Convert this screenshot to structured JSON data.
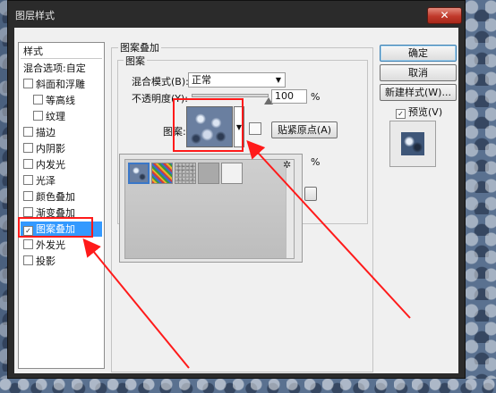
{
  "window": {
    "title": "图层样式",
    "close_label": "✕"
  },
  "style_list": {
    "header": "样式",
    "items": [
      {
        "label": "混合选项:自定",
        "has_checkbox": false,
        "checked": false,
        "selected": false,
        "indent": false
      },
      {
        "label": "斜面和浮雕",
        "has_checkbox": true,
        "checked": false,
        "selected": false,
        "indent": false
      },
      {
        "label": "等高线",
        "has_checkbox": true,
        "checked": false,
        "selected": false,
        "indent": true
      },
      {
        "label": "纹理",
        "has_checkbox": true,
        "checked": false,
        "selected": false,
        "indent": true
      },
      {
        "label": "描边",
        "has_checkbox": true,
        "checked": false,
        "selected": false,
        "indent": false
      },
      {
        "label": "内阴影",
        "has_checkbox": true,
        "checked": false,
        "selected": false,
        "indent": false
      },
      {
        "label": "内发光",
        "has_checkbox": true,
        "checked": false,
        "selected": false,
        "indent": false
      },
      {
        "label": "光泽",
        "has_checkbox": true,
        "checked": false,
        "selected": false,
        "indent": false
      },
      {
        "label": "颜色叠加",
        "has_checkbox": true,
        "checked": false,
        "selected": false,
        "indent": false
      },
      {
        "label": "渐变叠加",
        "has_checkbox": true,
        "checked": false,
        "selected": false,
        "indent": false
      },
      {
        "label": "图案叠加",
        "has_checkbox": true,
        "checked": true,
        "selected": true,
        "indent": false
      },
      {
        "label": "外发光",
        "has_checkbox": true,
        "checked": false,
        "selected": false,
        "indent": false
      },
      {
        "label": "投影",
        "has_checkbox": true,
        "checked": false,
        "selected": false,
        "indent": false
      }
    ]
  },
  "panel": {
    "group_title": "图案叠加",
    "subgroup_title": "图案",
    "blend_mode_label": "混合模式(B):",
    "blend_mode_value": "正常",
    "opacity_label": "不透明度(Y):",
    "opacity_value": "100",
    "opacity_unit": "%",
    "opacity_level": 1.0,
    "pattern_label": "图案:",
    "snap_origin_button": "贴紧原点(A)",
    "scale_unit": "%"
  },
  "side_buttons": {
    "ok": "确定",
    "cancel": "取消",
    "new_style": "新建样式(W)...",
    "preview_label": "预览(V)",
    "preview_checked": true
  },
  "pattern_picker": {
    "patterns": [
      "blue-bubbles",
      "rainbow-stripes",
      "gray-noise",
      "gray-fabric",
      "white-paper"
    ],
    "selected_index": 0
  },
  "colors": {
    "highlight": "#3399ff",
    "annotation_red": "#ff1a1a"
  }
}
